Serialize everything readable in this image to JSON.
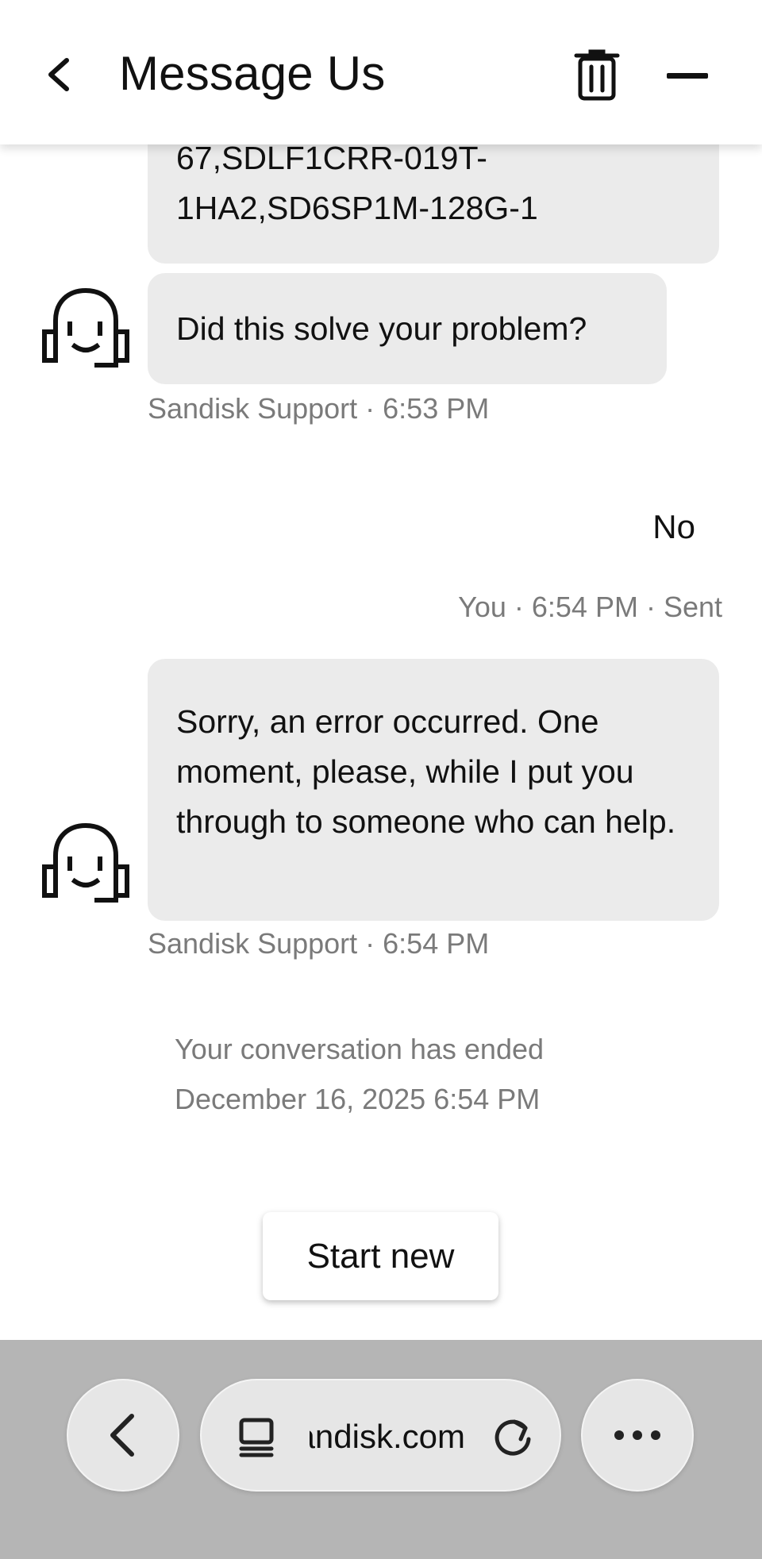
{
  "header": {
    "title": "Message Us",
    "back_icon": "chevron-left-icon",
    "trash_icon": "trash-icon",
    "minimize_icon": "minimize-icon"
  },
  "messages": {
    "bot1": {
      "lines": [
        "67,SDLF1CRR-019T-",
        "1HA2,SD6SP1M-128G-1"
      ]
    },
    "bot2": {
      "text": "Did this solve your problem?",
      "meta": "Sandisk Support · 6:53 PM"
    },
    "user1": {
      "text": "No",
      "meta": "You · 6:54 PM · Sent"
    },
    "bot3": {
      "text": "Sorry, an error occurred. One moment, please, while I put you through to someone who can help.",
      "meta": "Sandisk Support · 6:54 PM"
    }
  },
  "ended": {
    "line1": "Your conversation has ended",
    "line2": "December 16, 2025 6:54 PM"
  },
  "start_new_label": "Start new",
  "browser": {
    "url_text": "sandisk.com",
    "back_icon": "chevron-left-icon",
    "tabs_icon": "tabs-icon",
    "reload_icon": "reload-icon",
    "more_icon": "more-horizontal-icon"
  },
  "colors": {
    "bubble_bg": "#ebebeb",
    "meta_text": "#7a7a7a",
    "browser_bar_bg": "#b5b5b5"
  }
}
